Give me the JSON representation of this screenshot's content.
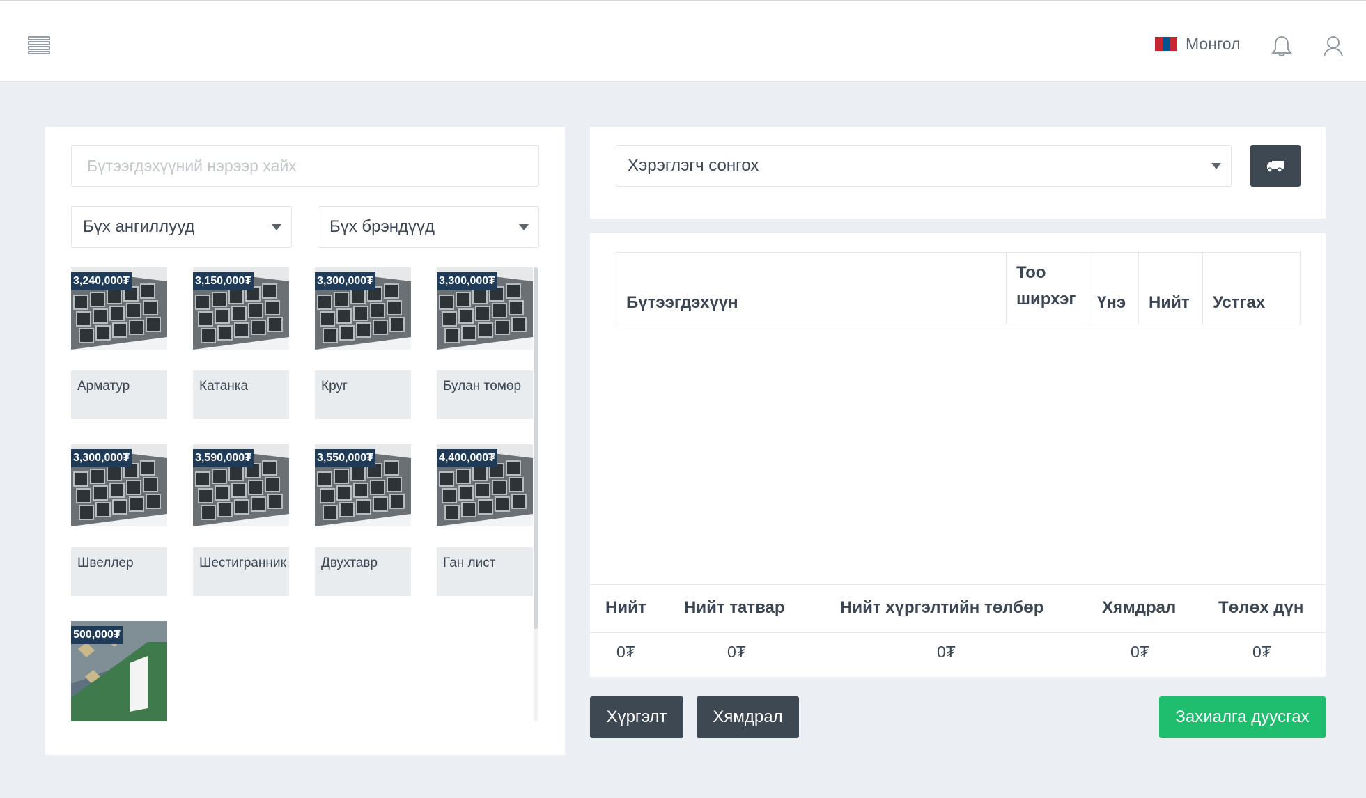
{
  "header": {
    "language": "Монгол",
    "flag_colors": [
      "#c4272f",
      "#015197",
      "#c4272f"
    ]
  },
  "filters": {
    "search_placeholder": "Бүтээгдэхүүний нэрээр хайх",
    "category": "Бүх ангиллууд",
    "brand": "Бүх брэндүүд"
  },
  "products": [
    {
      "price": "3,240,000₮",
      "name": "Арматур"
    },
    {
      "price": "3,150,000₮",
      "name": "Катанка"
    },
    {
      "price": "3,300,000₮",
      "name": "Круг"
    },
    {
      "price": "3,300,000₮",
      "name": "Булан төмөр"
    },
    {
      "price": "3,300,000₮",
      "name": "Швеллер"
    },
    {
      "price": "3,590,000₮",
      "name": "Шестигранник"
    },
    {
      "price": "3,550,000₮",
      "name": "Двухтавр"
    },
    {
      "price": "4,400,000₮",
      "name": "Ган лист"
    },
    {
      "price": "500,000₮",
      "name": ""
    }
  ],
  "customer": {
    "placeholder": "Хэрэглэгч сонгох"
  },
  "cart": {
    "columns": {
      "product": "Бүтээгдэхүүн",
      "qty_line1": "Тоо",
      "qty_line2": "ширхэг",
      "price": "Үнэ",
      "total": "Нийт",
      "remove": "Устгах"
    }
  },
  "totals": {
    "labels": {
      "total": "Нийт",
      "tax": "Нийт татвар",
      "delivery": "Нийт хүргэлтийн төлбөр",
      "discount": "Хямдрал",
      "payable": "Төлөх дүн"
    },
    "values": {
      "total": "0₮",
      "tax": "0₮",
      "delivery": "0₮",
      "discount": "0₮",
      "payable": "0₮"
    }
  },
  "actions": {
    "delivery": "Хүргэлт",
    "discount": "Хямдрал",
    "complete": "Захиалга дуусгах"
  },
  "colors": {
    "price_badge": "#1f3b57",
    "dark_button": "#3d4852",
    "green_button": "#1fbe6e"
  }
}
